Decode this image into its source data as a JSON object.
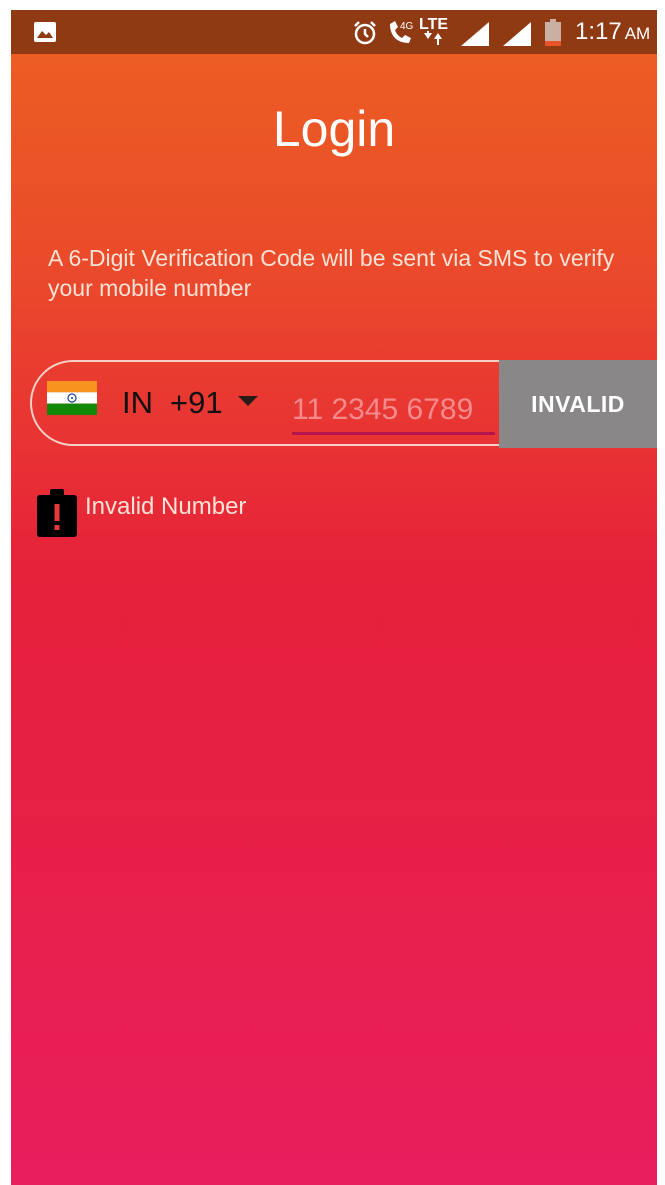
{
  "status_bar": {
    "time": "1:17",
    "ampm": "AM",
    "lte_label": "LTE",
    "network_label": "4G",
    "icons": [
      "gallery-icon",
      "alarm-icon",
      "call-icon",
      "lte-icon",
      "signal-icon",
      "signal-icon",
      "battery-icon"
    ],
    "bar_color": "#8f3a13"
  },
  "login": {
    "title": "Login",
    "subtitle": "A 6-Digit Verification Code will be sent via SMS to verify your mobile number"
  },
  "phone": {
    "country_code": "IN",
    "dial_code": "+91",
    "flag": "india-flag-icon",
    "placeholder": "11 2345 6789",
    "value": "",
    "button_label": "INVALID",
    "button_color": "#898787",
    "underline_color": "#b3154c"
  },
  "error": {
    "icon": "alert-clipboard-icon",
    "message": "Invalid Number"
  },
  "theme": {
    "gradient_top": "#ec6121",
    "gradient_bottom": "#e81e5e"
  }
}
